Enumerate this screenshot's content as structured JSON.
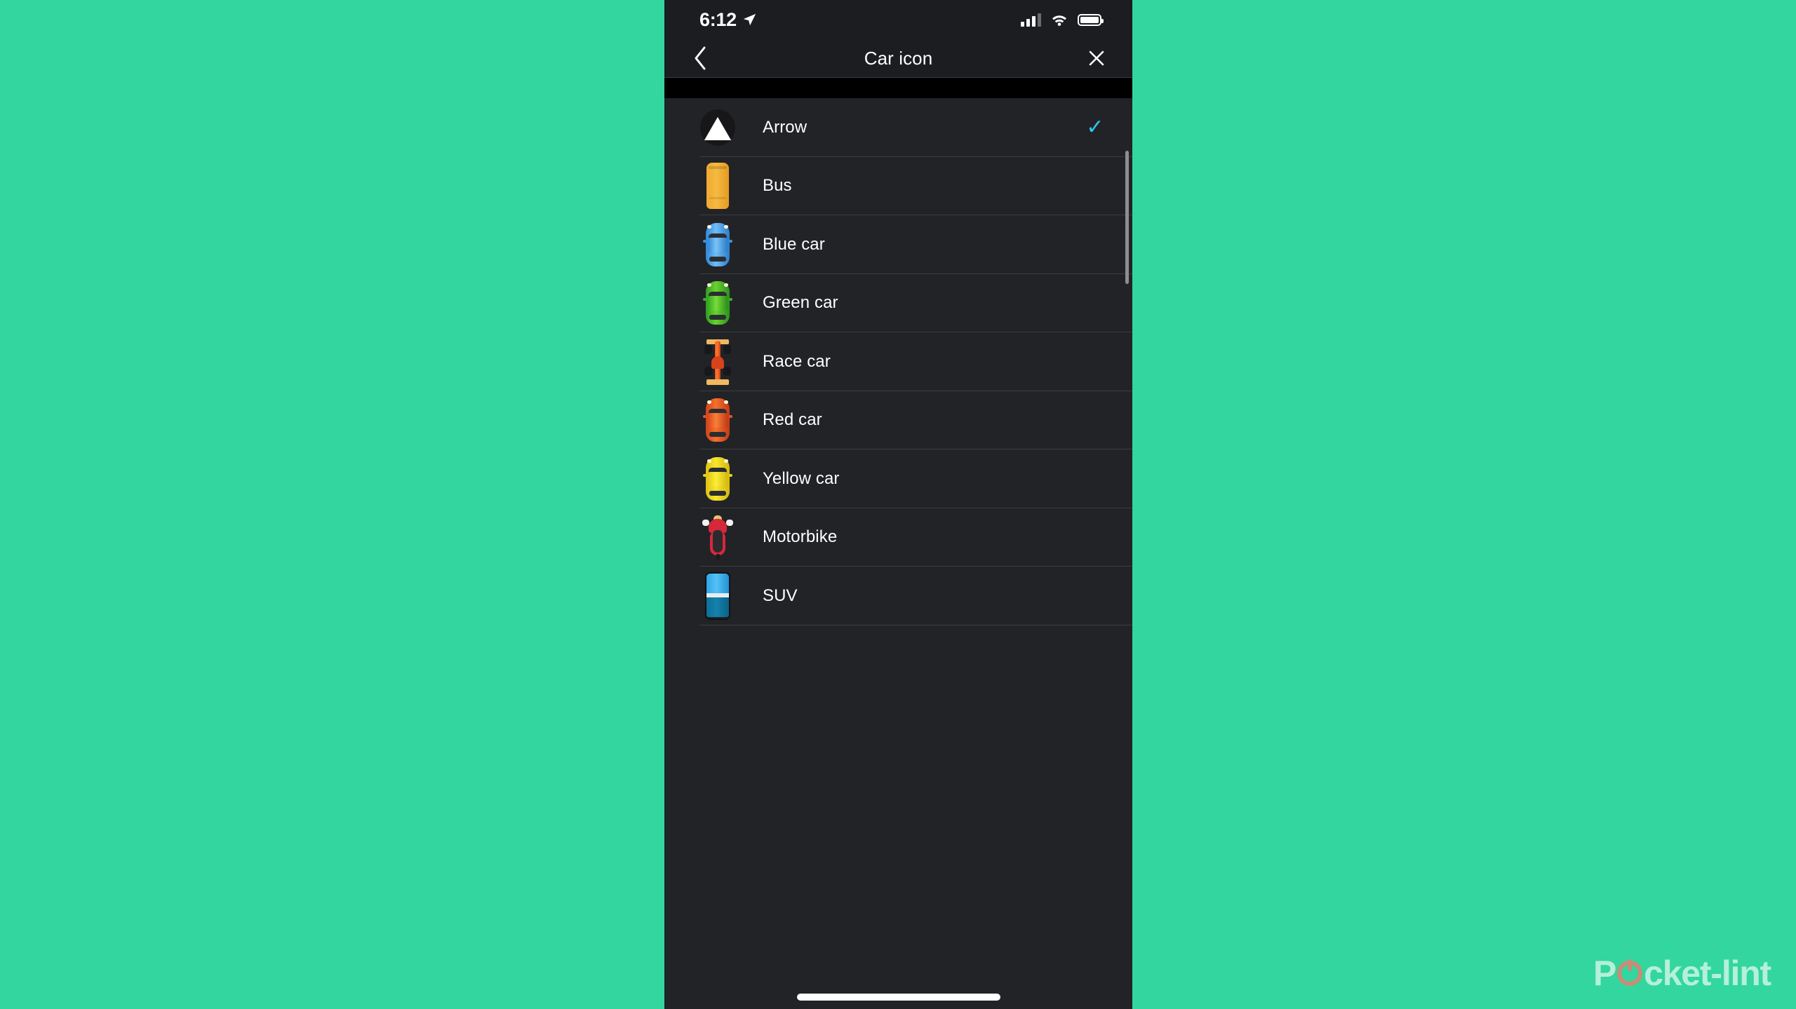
{
  "background_color": "#33d69f",
  "status_bar": {
    "time": "6:12",
    "location_icon": "location-arrow-icon",
    "signal_icon": "cellular-signal-icon",
    "wifi_icon": "wifi-icon",
    "battery_icon": "battery-full-icon"
  },
  "nav": {
    "back_icon": "chevron-left-icon",
    "title": "Car icon",
    "close_icon": "close-x-icon"
  },
  "colors": {
    "accent": "#2ec6ef",
    "screen_bg": "#1c1d21",
    "row_bg": "#222327",
    "separator": "#3c3d42",
    "text": "#ffffff"
  },
  "list": {
    "items": [
      {
        "label": "Arrow",
        "icon": "arrow-marker-icon",
        "selected": true,
        "check": "✓"
      },
      {
        "label": "Bus",
        "icon": "bus-icon",
        "selected": false,
        "check": ""
      },
      {
        "label": "Blue car",
        "icon": "blue-car-icon",
        "selected": false,
        "check": ""
      },
      {
        "label": "Green car",
        "icon": "green-car-icon",
        "selected": false,
        "check": ""
      },
      {
        "label": "Race car",
        "icon": "race-car-icon",
        "selected": false,
        "check": ""
      },
      {
        "label": "Red car",
        "icon": "red-car-icon",
        "selected": false,
        "check": ""
      },
      {
        "label": "Yellow car",
        "icon": "yellow-car-icon",
        "selected": false,
        "check": ""
      },
      {
        "label": "Motorbike",
        "icon": "motorbike-icon",
        "selected": false,
        "check": ""
      },
      {
        "label": "SUV",
        "icon": "suv-icon",
        "selected": false,
        "check": ""
      }
    ]
  },
  "watermark": {
    "text_before": "P",
    "text_after": "cket-lint"
  }
}
